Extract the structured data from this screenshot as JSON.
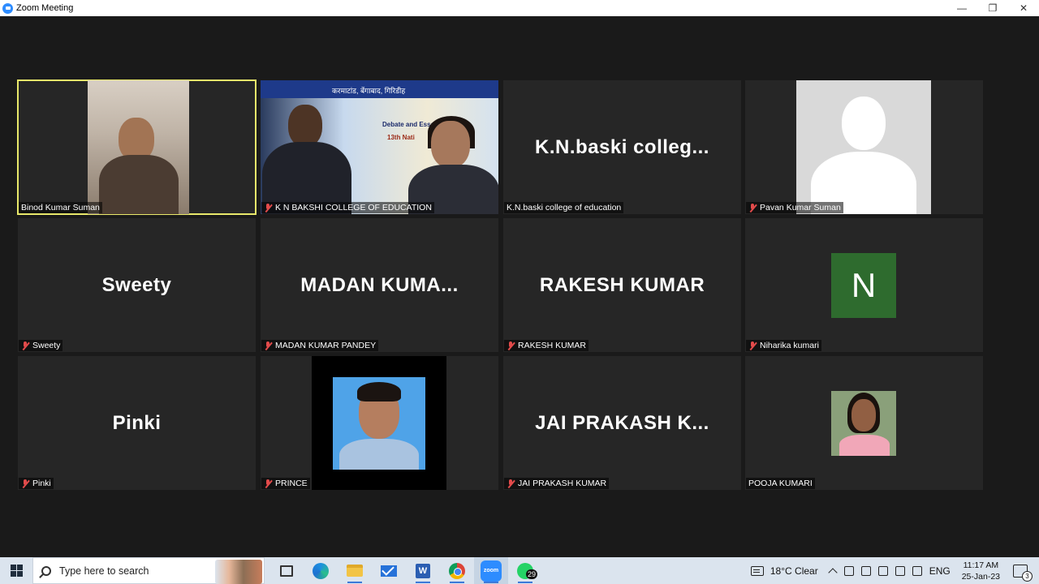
{
  "window": {
    "title": "Zoom Meeting",
    "controls": [
      "—",
      "❐",
      "✕"
    ]
  },
  "tiles": [
    {
      "display_name": "",
      "label": "Binod Kumar Suman",
      "muted": false,
      "active": true,
      "kind": "video"
    },
    {
      "display_name": "",
      "label": "K N BAKSHI COLLEGE OF EDUCATION",
      "muted": true,
      "active": false,
      "kind": "video",
      "banner": "करमाटांड, बेंगाबाद, गिरिडीह",
      "sign_text_1": "Debate and Essay",
      "sign_text_2": "13th Nati"
    },
    {
      "display_name": "K.N.baski  colleg...",
      "label": "K.N.baski college of education",
      "muted": false,
      "active": false,
      "kind": "name"
    },
    {
      "display_name": "",
      "label": "Pavan  Kumar Suman",
      "muted": true,
      "active": false,
      "kind": "avatar"
    },
    {
      "display_name": "Sweety",
      "label": "Sweety",
      "muted": true,
      "active": false,
      "kind": "name"
    },
    {
      "display_name": "MADAN  KUMA...",
      "label": "MADAN KUMAR PANDEY",
      "muted": true,
      "active": false,
      "kind": "name"
    },
    {
      "display_name": "RAKESH KUMAR",
      "label": "RAKESH KUMAR",
      "muted": true,
      "active": false,
      "kind": "name"
    },
    {
      "display_name": "N",
      "label": "Niharika kumari",
      "muted": true,
      "active": false,
      "kind": "initial",
      "initial_color": "#2e6b2e"
    },
    {
      "display_name": "Pinki",
      "label": "Pinki",
      "muted": true,
      "active": false,
      "kind": "name"
    },
    {
      "display_name": "",
      "label": "PRINCE",
      "muted": true,
      "active": false,
      "kind": "photo"
    },
    {
      "display_name": "JAI  PRAKASH  K...",
      "label": "JAI PRAKASH KUMAR",
      "muted": true,
      "active": false,
      "kind": "name"
    },
    {
      "display_name": "",
      "label": "POOJA KUMARI",
      "muted": false,
      "active": false,
      "kind": "photo"
    }
  ],
  "taskbar": {
    "search_placeholder": "Type here to search",
    "apps": [
      "task-view",
      "edge",
      "file-explorer",
      "mail",
      "word",
      "chrome",
      "zoom",
      "whatsapp"
    ],
    "whatsapp_badge": "29",
    "zoom_label": "zoom",
    "word_label": "W",
    "weather": "18°C  Clear",
    "language": "ENG",
    "time": "11:17 AM",
    "date": "25-Jan-23",
    "notification_count": "3"
  },
  "colors": {
    "active_speaker_border": "#e8e86a",
    "tile_bg": "#262626",
    "meeting_bg": "#1a1a1a",
    "muted_icon": "#e24b4b"
  }
}
